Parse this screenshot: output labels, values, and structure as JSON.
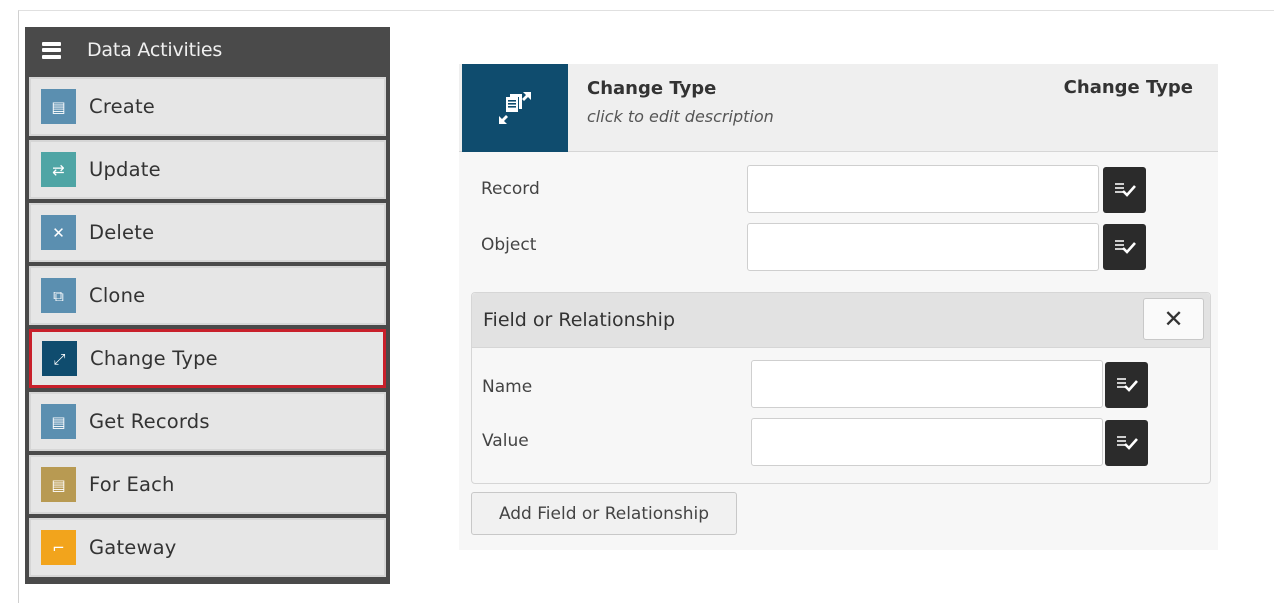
{
  "sidebar": {
    "title": "Data Activities",
    "items": [
      {
        "label": "Create",
        "icon": "create-icon",
        "color": "#5b8fb0",
        "glyph": "▤"
      },
      {
        "label": "Update",
        "icon": "update-icon",
        "color": "#4fa5a5",
        "glyph": "⇄"
      },
      {
        "label": "Delete",
        "icon": "delete-icon",
        "color": "#5b8fb0",
        "glyph": "✕"
      },
      {
        "label": "Clone",
        "icon": "clone-icon",
        "color": "#5b8fb0",
        "glyph": "⧉"
      },
      {
        "label": "Change Type",
        "icon": "change-type-icon",
        "color": "#0f4c6e",
        "glyph": "⤢",
        "selected": true
      },
      {
        "label": "Get Records",
        "icon": "get-records-icon",
        "color": "#5b8fb0",
        "glyph": "▤"
      },
      {
        "label": "For Each",
        "icon": "for-each-icon",
        "color": "#b89a52",
        "glyph": "▤"
      },
      {
        "label": "Gateway",
        "icon": "gateway-icon",
        "color": "#f2a41c",
        "glyph": "⌐"
      }
    ]
  },
  "panel": {
    "title": "Change Type",
    "description": "click to edit description",
    "type_label": "Change Type",
    "fields": {
      "record_label": "Record",
      "object_label": "Object"
    },
    "group": {
      "title": "Field or Relationship",
      "close_glyph": "✕",
      "name_label": "Name",
      "value_label": "Value"
    },
    "add_button": "Add Field or Relationship"
  },
  "colors": {
    "selected_border": "#c8202b",
    "header_icon_bg": "#0f4c6e",
    "picker_bg": "#2b2b2b"
  }
}
